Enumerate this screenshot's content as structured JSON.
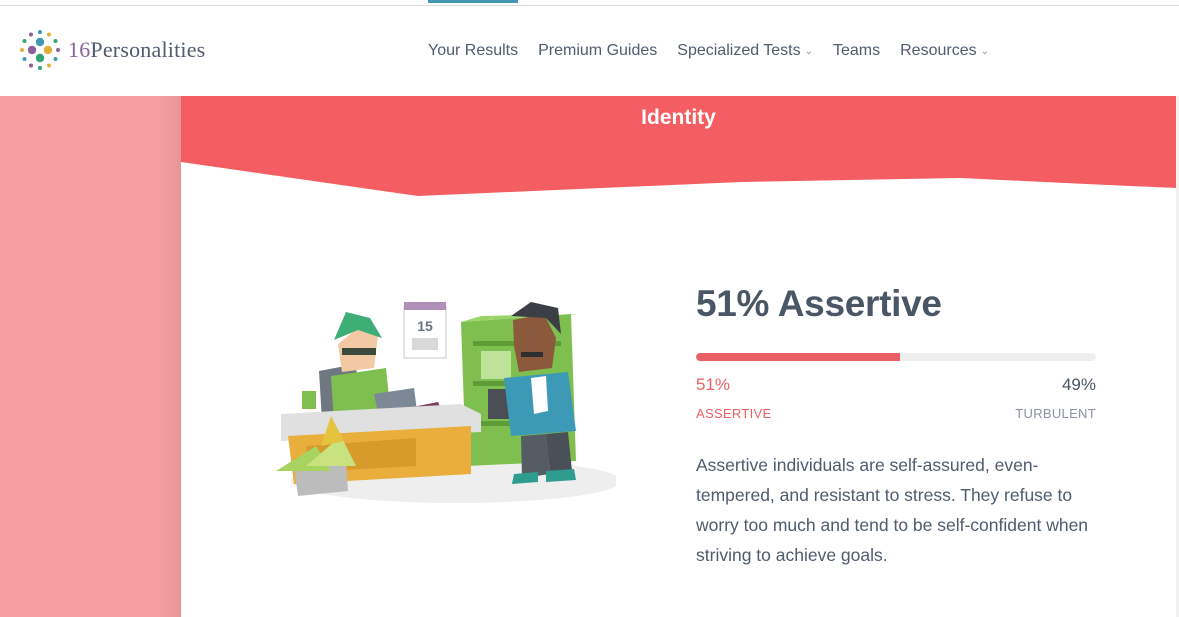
{
  "header": {
    "logo": {
      "number": "16",
      "word": "Personalities"
    },
    "nav": [
      {
        "label": "Your Results",
        "active": true,
        "dropdown": false
      },
      {
        "label": "Premium Guides",
        "active": false,
        "dropdown": false
      },
      {
        "label": "Specialized Tests",
        "active": false,
        "dropdown": true
      },
      {
        "label": "Teams",
        "active": false,
        "dropdown": false
      },
      {
        "label": "Resources",
        "active": false,
        "dropdown": true
      }
    ],
    "dropdown_icon": "chevron-down-icon"
  },
  "section": {
    "title": "Identity",
    "result_title": "51% Assertive",
    "meter": {
      "value": 51,
      "left_percent": "51%",
      "right_percent": "49%",
      "left_label": "ASSERTIVE",
      "right_label": "TURBULENT"
    },
    "description": "Assertive individuals are self-assured, even-tempered, and resistant to stress. They refuse to worry too much and tend to be self-confident when striving to achieve goals.",
    "illustration_calendar_day": "15"
  },
  "colors": {
    "banner": "#f45e63",
    "accent_red": "#ea5f65",
    "left_strip": "#f59fa1",
    "nav_active": "#4298b4",
    "text": "#4f5c6e"
  }
}
